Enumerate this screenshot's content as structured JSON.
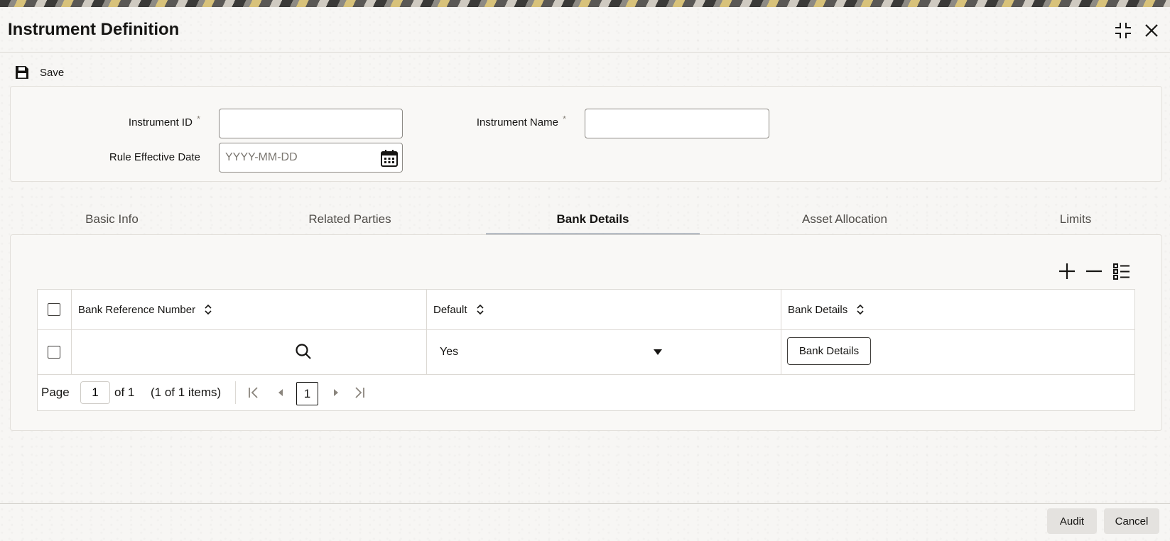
{
  "window": {
    "title": "Instrument Definition",
    "icons": [
      "minimize-icon",
      "close-icon"
    ]
  },
  "toolbar": {
    "save_label": "Save",
    "save_icon": "save-icon"
  },
  "form": {
    "instrument_id": {
      "label": "Instrument ID",
      "required": "*",
      "value": ""
    },
    "instrument_name": {
      "label": "Instrument Name",
      "required": "*",
      "value": ""
    },
    "rule_effective_date": {
      "label": "Rule Effective Date",
      "value": "",
      "placeholder": "YYYY-MM-DD",
      "icon": "calendar-icon"
    }
  },
  "tabs": [
    {
      "label": "Basic Info",
      "active": false
    },
    {
      "label": "Related Parties",
      "active": false
    },
    {
      "label": "Bank Details",
      "active": true
    },
    {
      "label": "Asset Allocation",
      "active": false
    },
    {
      "label": "Limits",
      "active": false
    }
  ],
  "table": {
    "actions": [
      "add-row-icon",
      "delete-row-icon",
      "single-record-view-icon"
    ],
    "columns": [
      {
        "label": "Bank Reference Number"
      },
      {
        "label": "Default"
      },
      {
        "label": "Bank Details"
      }
    ],
    "rows": [
      {
        "bank_reference_number": "",
        "default": "Yes",
        "bank_details_button": "Bank Details"
      }
    ],
    "pagination": {
      "page_label": "Page",
      "current_page": "1",
      "of_label": "of 1",
      "items_summary": "(1 of 1 items)",
      "page_button": "1"
    }
  },
  "footer": {
    "audit_label": "Audit",
    "cancel_label": "Cancel"
  },
  "colors": {
    "accent_tab": "#4b5c75",
    "footer_button": "#e4e2df"
  }
}
